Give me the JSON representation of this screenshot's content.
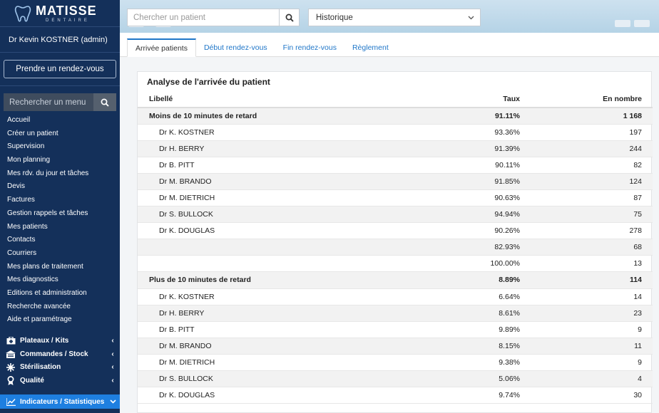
{
  "app": {
    "logo_name": "MATISSE",
    "logo_sub": "DENTAIRE"
  },
  "sidebar": {
    "user": "Dr Kevin KOSTNER (admin)",
    "appointment_button": "Prendre un rendez-vous",
    "menu_search_placeholder": "Rechercher un menu",
    "items": [
      "Accueil",
      "Créer un patient",
      "Supervision",
      "Mon planning",
      "Mes rdv. du jour et tâches",
      "Devis",
      "Factures",
      "Gestion rappels et tâches",
      "Mes patients",
      "Contacts",
      "Courriers",
      "Mes plans de traitement",
      "Mes diagnostics",
      "Editions et administration",
      "Recherche avancée",
      "Aide et paramétrage"
    ],
    "groups": [
      {
        "label": "Plateaux / Kits",
        "icon": "kit-icon"
      },
      {
        "label": "Commandes / Stock",
        "icon": "stock-icon"
      },
      {
        "label": "Stérilisation",
        "icon": "sterilisation-icon"
      },
      {
        "label": "Qualité",
        "icon": "quality-icon"
      }
    ],
    "active_group": {
      "label": "Indicateurs / Statistiques",
      "icon": "chart-icon"
    }
  },
  "topbar": {
    "patient_search_placeholder": "Chercher un patient",
    "history_select": "Historique"
  },
  "tabs": [
    "Arrivée patients",
    "Début rendez-vous",
    "Fin rendez-vous",
    "Règlement"
  ],
  "panel": {
    "title": "Analyse de l'arrivée du patient",
    "columns": {
      "label": "Libellé",
      "rate": "Taux",
      "count": "En nombre"
    },
    "rows": [
      {
        "label": "Moins de 10 minutes de retard",
        "rate": "91.11%",
        "count": "1 168",
        "group": true
      },
      {
        "label": "Dr K. KOSTNER",
        "rate": "93.36%",
        "count": "197"
      },
      {
        "label": "Dr H. BERRY",
        "rate": "91.39%",
        "count": "244"
      },
      {
        "label": "Dr B. PITT",
        "rate": "90.11%",
        "count": "82"
      },
      {
        "label": "Dr M. BRANDO",
        "rate": "91.85%",
        "count": "124"
      },
      {
        "label": "Dr M. DIETRICH",
        "rate": "90.63%",
        "count": "87"
      },
      {
        "label": "Dr S. BULLOCK",
        "rate": "94.94%",
        "count": "75"
      },
      {
        "label": "Dr K. DOUGLAS",
        "rate": "90.26%",
        "count": "278"
      },
      {
        "label": "",
        "rate": "82.93%",
        "count": "68"
      },
      {
        "label": "",
        "rate": "100.00%",
        "count": "13"
      },
      {
        "label": "Plus de 10 minutes de retard",
        "rate": "8.89%",
        "count": "114",
        "group": true
      },
      {
        "label": "Dr K. KOSTNER",
        "rate": "6.64%",
        "count": "14"
      },
      {
        "label": "Dr H. BERRY",
        "rate": "8.61%",
        "count": "23"
      },
      {
        "label": "Dr B. PITT",
        "rate": "9.89%",
        "count": "9"
      },
      {
        "label": "Dr M. BRANDO",
        "rate": "8.15%",
        "count": "11"
      },
      {
        "label": "Dr M. DIETRICH",
        "rate": "9.38%",
        "count": "9"
      },
      {
        "label": "Dr S. BULLOCK",
        "rate": "5.06%",
        "count": "4"
      },
      {
        "label": "Dr K. DOUGLAS",
        "rate": "9.74%",
        "count": "30"
      }
    ]
  },
  "colors": {
    "sidebar": "#14305a",
    "active": "#1e7fe0",
    "link": "#1f76c8"
  }
}
